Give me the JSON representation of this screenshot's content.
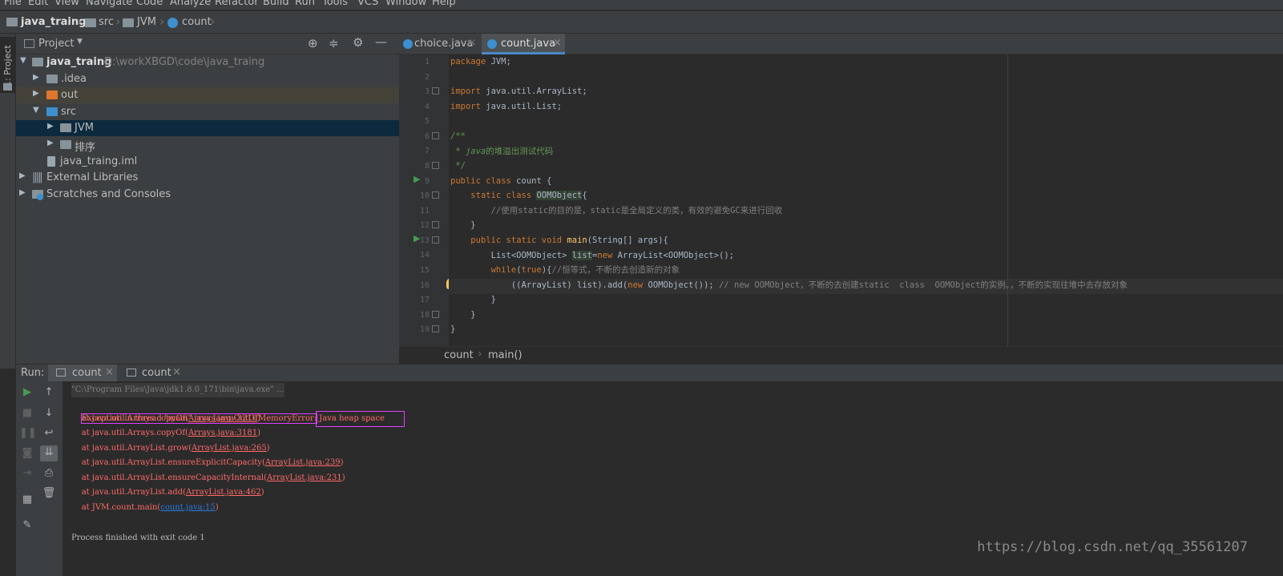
{
  "menubar": {
    "items": [
      "File",
      "Edit",
      "View",
      "Navigate",
      "Code",
      "Analyze",
      "Refactor",
      "Build",
      "Run",
      "Tools",
      "VCS",
      "Window",
      "Help"
    ]
  },
  "navbar": {
    "project": "java_traing",
    "src": "src",
    "jvm": "JVM",
    "file": "count"
  },
  "sidestrip": {
    "label": "1: Project"
  },
  "project_panel": {
    "title": "Project",
    "root_name": "java_traing",
    "root_path": "D:\\workXBGD\\code\\java_traing",
    "items": [
      ".idea",
      "out",
      "src",
      "JVM",
      "排序",
      "java_traing.iml",
      "External Libraries",
      "Scratches and Consoles"
    ]
  },
  "editor": {
    "tabs": [
      "choice.java",
      "count.java"
    ],
    "line_numbers": [
      "1",
      "2",
      "3",
      "4",
      "5",
      "6",
      "7",
      "8",
      "9",
      "10",
      "11",
      "12",
      "13",
      "14",
      "15",
      "16",
      "17",
      "18",
      "19"
    ],
    "code": {
      "l1_kw": "package",
      "l1_rest": " JVM;",
      "l3_kw": "import",
      "l3_rest": " java.util.ArrayList;",
      "l4_kw": "import",
      "l4_rest": " java.util.List;",
      "l6": "/**",
      "l7_a": " * ",
      "l7_b": "java",
      "l7_c": "的堆溢出测试代码",
      "l8": " */",
      "l9_kw": "public class",
      "l9_rest": " count {",
      "l10_ind": "    ",
      "l10_kw": "static class",
      "l10_sp": " ",
      "l10_cls": "OOMObject",
      "l10_end": "{",
      "l11": "        //使用static的目的是，static是全局定义的类，有效的避免GC来进行回收",
      "l12": "    }",
      "l13_ind": "    ",
      "l13_kw": "public static void",
      "l13_sp": " ",
      "l13_fn": "main",
      "l13_rest": "(String[] args){",
      "l14_a": "        List<OOMObject> ",
      "l14_b": "list",
      "l14_c": "=",
      "l14_kw": "new",
      "l14_d": " ArrayList<OOMObject>();",
      "l15_ind": "        ",
      "l15_kw": "while",
      "l15_a": "(",
      "l15_kw2": "true",
      "l15_b": "){",
      "l15_cm": "//恒等式，不断的去创造新的对象",
      "l16_a": "            ((ArrayList) list).add(",
      "l16_kw": "new",
      "l16_b": " OOMObject()); ",
      "l16_cm": "// new OOMObject，不断的去创建static  class  OOMObject的实例。，不断的实现往堆中去存放对象",
      "l17": "        }",
      "l18": "    }",
      "l19": "}"
    },
    "breadcrumb": {
      "cls": "count",
      "method": "main()"
    }
  },
  "run": {
    "label": "Run:",
    "tabs": [
      "count",
      "count"
    ],
    "console": {
      "cmd": "\"C:\\Program Files\\Java\\jdk1.8.0_171\\bin\\java.exe\" ...",
      "exc_a": "Exception in thread \"main\" java.lang.OutOfMemoryError:",
      "exc_b": " Java heap space",
      "frames": [
        {
          "pre": "    at java.util.Arrays.copyOf(",
          "link": "Arrays.java:3210",
          "post": ")"
        },
        {
          "pre": "    at java.util.Arrays.copyOf(",
          "link": "Arrays.java:3181",
          "post": ")"
        },
        {
          "pre": "    at java.util.ArrayList.grow(",
          "link": "ArrayList.java:265",
          "post": ")"
        },
        {
          "pre": "    at java.util.ArrayList.ensureExplicitCapacity(",
          "link": "ArrayList.java:239",
          "post": ")"
        },
        {
          "pre": "    at java.util.ArrayList.ensureCapacityInternal(",
          "link": "ArrayList.java:231",
          "post": ")"
        },
        {
          "pre": "    at java.util.ArrayList.add(",
          "link": "ArrayList.java:462",
          "post": ")"
        },
        {
          "pre": "    at JVM.count.main(",
          "link": "count.java:15",
          "post": ")"
        }
      ],
      "exit": "Process finished with exit code 1"
    }
  },
  "watermark": "https://blog.csdn.net/qq_35561207",
  "colors": {
    "highlight_box": "#e040fb",
    "selection": "#0d293e",
    "error": "#ff6b68"
  }
}
